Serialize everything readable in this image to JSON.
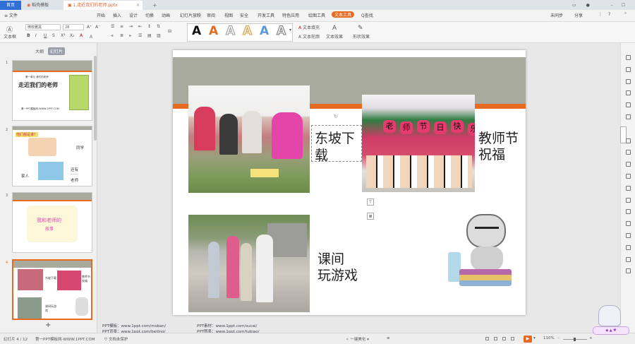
{
  "tabs": {
    "home": "首页",
    "rice": "稻壳模板",
    "doc": "1.走近我们的老师.pptx"
  },
  "menu": {
    "file": "≡ 文件",
    "items": [
      "开始",
      "插入",
      "设计",
      "切换",
      "动画",
      "幻灯片放映",
      "审阅",
      "视图",
      "安全",
      "开发工具",
      "特色应用",
      "绘图工具",
      "文本工具",
      "Q查找"
    ],
    "right": [
      "未同步",
      "分享"
    ]
  },
  "toolbar": {
    "font_name": "微软雅黑",
    "font_size": "28",
    "textbox_label": "文本框",
    "text_fill": "文本填充",
    "text_outline": "文本轮廓",
    "text_effect": "文本效果",
    "shape_label": "形状效果",
    "format_painter": "格式刷",
    "art_letters": [
      "A",
      "A",
      "A",
      "A",
      "A",
      "A"
    ]
  },
  "leftpane": {
    "tab_outline": "大纲",
    "tab_slides": "幻灯片",
    "nums": [
      "1",
      "2",
      "3",
      "4"
    ],
    "add": "+"
  },
  "thumb1": {
    "small": "第一单元 我们的老师",
    "title": "走近我们的老师",
    "site": "第一PPT模板网-WWW.1PPT.COM"
  },
  "thumb2": {
    "q": "他们都是谁？",
    "tongxue": "同学",
    "jiaren": "家人",
    "haiyou": "还有",
    "dots": "……",
    "laoshi": "老师"
  },
  "thumb3": {
    "line1": "我和老师的",
    "line2": "故事"
  },
  "thumb4": {
    "a": "东坡下载",
    "b": "教师节祝福",
    "c": "课间玩游戏"
  },
  "slide": {
    "label1": "东坡下载",
    "label1_a": "东坡下",
    "label1_b": "载",
    "label2_a": "教师节",
    "label2_b": "祝福",
    "label3_a": "课间",
    "label3_b": "玩游戏",
    "sign_chars": [
      "老",
      "师",
      "节",
      "日",
      "快",
      "乐"
    ]
  },
  "notes": {
    "l1": "PPT模板：www.1ppt.com/moban/",
    "l2": "PPT素材：www.1ppt.com/sucai/",
    "l3": "PPT背景：www.1ppt.com/beijing/",
    "l4": "PPT图表：www.1ppt.com/tubiao/"
  },
  "status": {
    "slide": "幻灯片 4 / 12",
    "template": "第一PPT模板网-WWW.1PPT.COM",
    "protect": "文档未保护",
    "beautify": "一键美化",
    "zoom": "110%"
  },
  "colors": {
    "accent": "#e66a21",
    "band": "#a7aa9d",
    "wps_blue": "#2f6fd6"
  }
}
